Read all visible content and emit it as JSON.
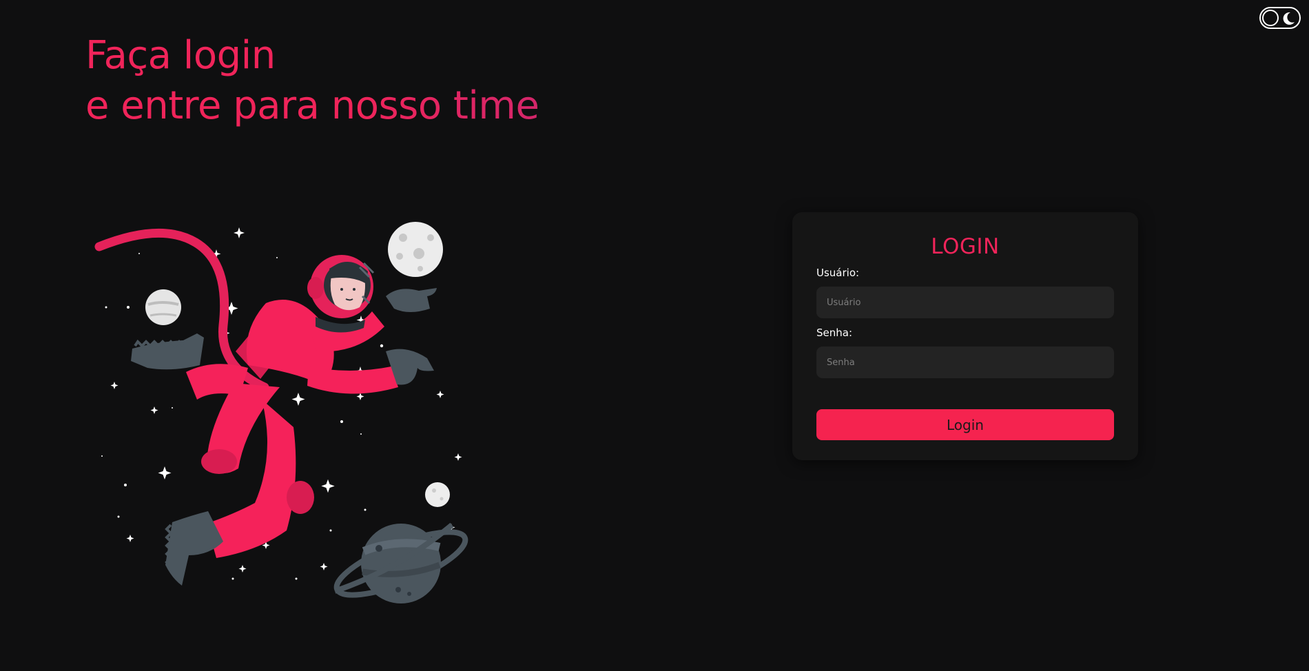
{
  "header": {
    "line1": "Faça login",
    "line2": "e entre para nosso time"
  },
  "theme_toggle": {
    "icon": "moon-icon"
  },
  "illustration": {
    "subject": "astronaut-floating-in-space"
  },
  "login_form": {
    "title": "LOGIN",
    "username_label": "Usuário:",
    "username_placeholder": "Usuário",
    "username_value": "",
    "password_label": "Senha:",
    "password_placeholder": "Senha",
    "password_value": "",
    "submit_label": "Login"
  },
  "colors": {
    "background": "#0f0f10",
    "accent": "#f0245a",
    "card": "#151515",
    "input": "#232323",
    "button": "#f5234f"
  }
}
